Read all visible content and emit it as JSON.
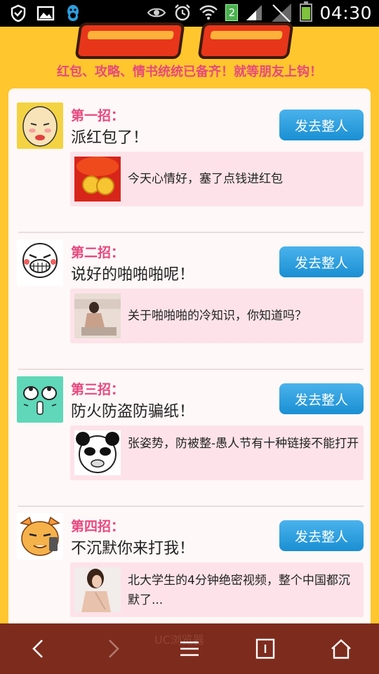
{
  "status_bar": {
    "time": "04:30",
    "sim_badge": "2",
    "icons": [
      "shield-icon",
      "image-icon",
      "qq-penguin-icon",
      "eye-icon",
      "alarm-icon",
      "wifi-icon",
      "signal-icon",
      "battery-icon"
    ]
  },
  "banner": {
    "tagline": "红包、攻略、情书统统已备齐！就等朋友上钩！"
  },
  "items": [
    {
      "step": "第一招：",
      "title": "派红包了！",
      "button": "发去整人",
      "sub_text": "今天心情好，塞了点钱进红包"
    },
    {
      "step": "第二招：",
      "title": "说好的啪啪啪呢！",
      "button": "发去整人",
      "sub_text": "关于啪啪啪的冷知识，你知道吗？"
    },
    {
      "step": "第三招：",
      "title": "防火防盗防骗纸！",
      "button": "发去整人",
      "sub_text": "张姿势，防被整-愚人节有十种链接不能打开"
    },
    {
      "step": "第四招：",
      "title": "不沉默你来打我！",
      "button": "发去整人",
      "sub_text": "北大学生的4分钟绝密视频，整个中国都沉默了..."
    }
  ],
  "browser_bar": {
    "brand": "UC浏览器",
    "icons": [
      "back-icon",
      "forward-icon",
      "menu-icon",
      "window-icon",
      "home-icon"
    ]
  },
  "colors": {
    "background": "#ffc62e",
    "accent_pink": "#e8477e",
    "button_blue": "#2b9fe0",
    "nav_brown": "#7d2b1d"
  }
}
